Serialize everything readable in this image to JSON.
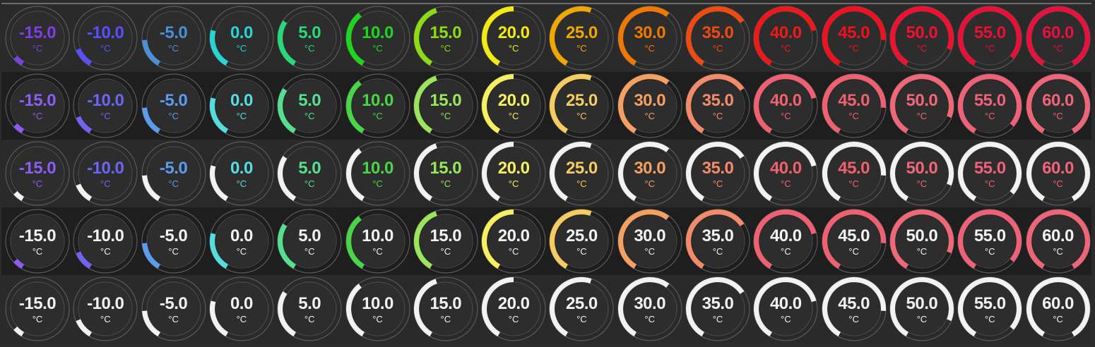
{
  "unit": "°C",
  "range": {
    "min": -20,
    "max": 60
  },
  "values": [
    -15.0,
    -10.0,
    -5.0,
    0.0,
    5.0,
    10.0,
    15.0,
    20.0,
    25.0,
    30.0,
    35.0,
    40.0,
    45.0,
    50.0,
    55.0,
    60.0
  ],
  "value_labels": [
    "-15.0",
    "-10.0",
    "-5.0",
    "0.0",
    "5.0",
    "10.0",
    "15.0",
    "20.0",
    "25.0",
    "30.0",
    "35.0",
    "40.0",
    "45.0",
    "50.0",
    "55.0",
    "60.0"
  ],
  "palettes": {
    "vivid": [
      "#7b3fe4",
      "#5a4fff",
      "#4a8fd8",
      "#26d6d6",
      "#27d977",
      "#1fd61f",
      "#8bdc14",
      "#f2ea12",
      "#f0a800",
      "#f07800",
      "#f04a10",
      "#f01818",
      "#f01020",
      "#f01030",
      "#e81036",
      "#e8103c"
    ],
    "pastel": [
      "#8f5bf5",
      "#6f63f5",
      "#5a9cf0",
      "#55dede",
      "#55e08f",
      "#48d648",
      "#9ae65a",
      "#f5f060",
      "#f5cc60",
      "#f5a060",
      "#f58a6a",
      "#f06070",
      "#f06070",
      "#f06878",
      "#f06078",
      "#f06478"
    ],
    "white": "#f2f2f2"
  },
  "rows": [
    {
      "arc": "vivid",
      "text": "vivid"
    },
    {
      "arc": "pastel",
      "text": "pastel"
    },
    {
      "arc": "white",
      "text": "pastel"
    },
    {
      "arc": "pastel",
      "text": "white"
    },
    {
      "arc": "white",
      "text": "white"
    }
  ]
}
